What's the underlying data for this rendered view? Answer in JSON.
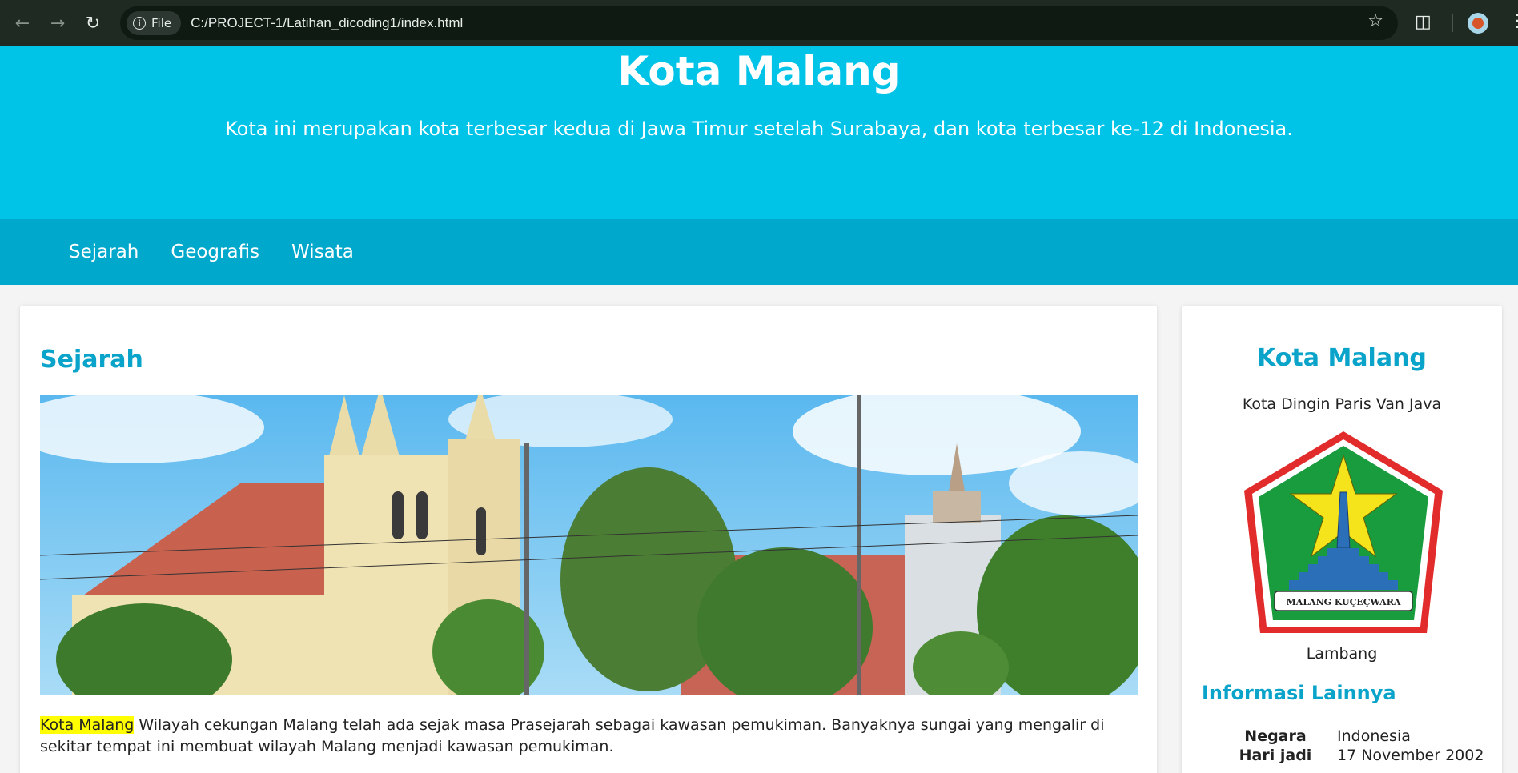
{
  "browser": {
    "chip_label": "File",
    "url": "C:/PROJECT-1/Latihan_dicoding1/index.html"
  },
  "hero": {
    "title": "Kota Malang",
    "subtitle": "Kota ini merupakan kota terbesar kedua di Jawa Timur setelah Surabaya, dan kota terbesar ke-12 di Indonesia."
  },
  "nav": {
    "items": [
      {
        "label": "Sejarah"
      },
      {
        "label": "Geografis"
      },
      {
        "label": "Wisata"
      }
    ]
  },
  "main": {
    "section_title": "Sejarah",
    "highlight": "Kota Malang",
    "paragraph": " Wilayah cekungan Malang telah ada sejak masa Prasejarah sebagai kawasan pemukiman. Banyaknya sungai yang mengalir di sekitar tempat ini membuat wilayah Malang menjadi kawasan pemukiman."
  },
  "aside": {
    "title": "Kota Malang",
    "tagline": "Kota Dingin Paris Van Java",
    "emblem_text": "MALANG KUÇEÇWARA",
    "emblem_caption": "Lambang",
    "info_title": "Informasi Lainnya",
    "info_rows": [
      {
        "key": "Negara",
        "value": "Indonesia"
      },
      {
        "key": "Hari jadi",
        "value": "17 November 2002"
      }
    ]
  },
  "colors": {
    "hero_bg": "#00c3e8",
    "nav_bg": "#00a8cc",
    "heading": "#0aa3c9",
    "highlight": "#ffff00"
  }
}
